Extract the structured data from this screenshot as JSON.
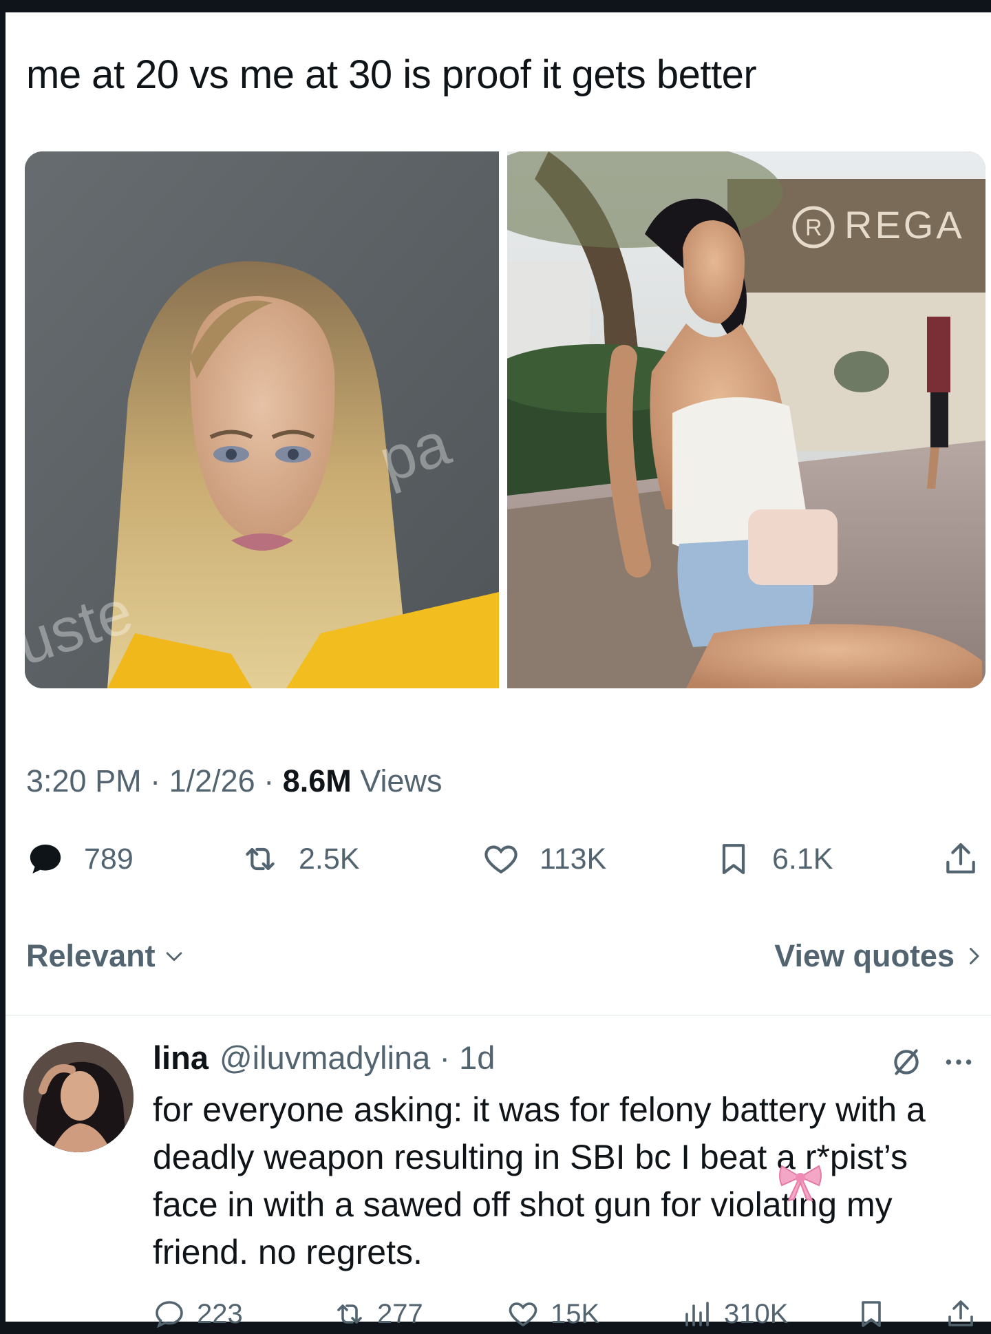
{
  "post": {
    "text": "me at 20 vs me at 30 is proof it gets better",
    "meta_time_date": "3:20 PM · 1/2/26 · ",
    "meta_views_count": "8.6M",
    "meta_views_label": " Views",
    "photo_left_watermark": "uste",
    "photo_left_watermark2": "pa",
    "photo_right_sign": "REGA"
  },
  "actions": {
    "replies": "789",
    "reposts": "2.5K",
    "likes": "113K",
    "bookmarks": "6.1K"
  },
  "sort": {
    "relevant_label": "Relevant",
    "view_quotes_label": "View quotes"
  },
  "reply": {
    "name": "lina",
    "handle": "@iluvmadylina · 1d",
    "body": "for everyone asking: it was for felony battery with a deadly weapon resulting in SBI bc I beat a r*pist’s face in with a sawed off shot gun for violating my friend. no regrets.",
    "replies": "223",
    "reposts": "277",
    "likes": "15K",
    "views": "310K"
  },
  "colors": {
    "text_primary": "#0f1419",
    "text_secondary": "#536471",
    "bow_pink": "#f4a6c6"
  },
  "icons": [
    "reply-icon",
    "repost-icon",
    "like-icon",
    "bookmark-icon",
    "share-icon",
    "chevron-down-icon",
    "chevron-right-icon",
    "grok-icon",
    "more-icon",
    "views-icon",
    "bow-emoji-icon"
  ]
}
